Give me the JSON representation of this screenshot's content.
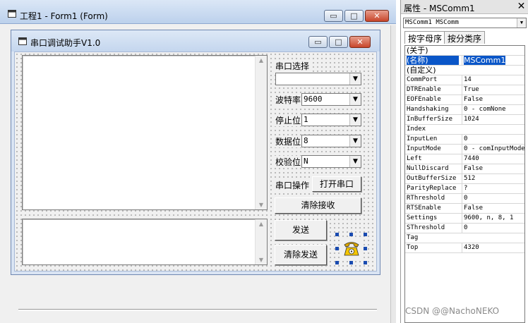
{
  "outer_window": {
    "title": "工程1 - Form1 (Form)",
    "min_glyph": "▭",
    "max_glyph": "□",
    "close_glyph": "✕"
  },
  "form": {
    "title": "串口调试助手V1.0",
    "min_glyph": "▭",
    "max_glyph": "□",
    "close_glyph": "✕",
    "labels": {
      "port_select": "串口选择",
      "baud_rate": "波特率",
      "stop_bits": "停止位",
      "data_bits": "数据位",
      "parity": "校验位",
      "port_op": "串口操作"
    },
    "combos": {
      "port": "",
      "baud": "9600",
      "stop": "1",
      "data": "8",
      "parity": "N"
    },
    "buttons": {
      "open_port": "打开串口",
      "clear_receive": "清除接收",
      "send": "发送",
      "clear_send": "清除发送"
    }
  },
  "properties": {
    "title": "属性 - MSComm1",
    "close_glyph": "✕",
    "object": "MSComm1 MSComm",
    "tabs": [
      "按字母序",
      "按分类序"
    ],
    "rows": [
      {
        "key": "(关于)",
        "value": ""
      },
      {
        "key": "(名称)",
        "value": "MSComm1"
      },
      {
        "key": "(自定义)",
        "value": ""
      },
      {
        "key": "CommPort",
        "value": "14"
      },
      {
        "key": "DTREnable",
        "value": "True"
      },
      {
        "key": "EOFEnable",
        "value": "False"
      },
      {
        "key": "Handshaking",
        "value": "0 - comNone"
      },
      {
        "key": "InBufferSize",
        "value": "1024"
      },
      {
        "key": "Index",
        "value": ""
      },
      {
        "key": "InputLen",
        "value": "0"
      },
      {
        "key": "InputMode",
        "value": "0 - comInputMode"
      },
      {
        "key": "Left",
        "value": "7440"
      },
      {
        "key": "NullDiscard",
        "value": "False"
      },
      {
        "key": "OutBufferSize",
        "value": "512"
      },
      {
        "key": "ParityReplace",
        "value": "?"
      },
      {
        "key": "RThreshold",
        "value": "0"
      },
      {
        "key": "RTSEnable",
        "value": "False"
      },
      {
        "key": "Settings",
        "value": "9600, n, 8, 1"
      },
      {
        "key": "SThreshold",
        "value": "0"
      },
      {
        "key": "Tag",
        "value": ""
      },
      {
        "key": "Top",
        "value": "4320"
      }
    ]
  },
  "watermark": "CSDN @@NachoNEKO",
  "colors": {
    "selection": "#0a56c8",
    "title_gradient_top": "#dbe7f6",
    "close_button": "#c8452b"
  }
}
